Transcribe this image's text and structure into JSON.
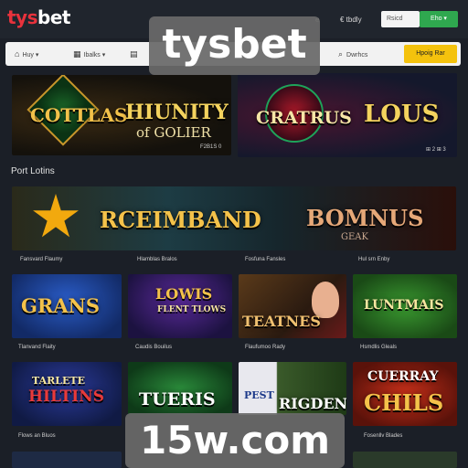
{
  "header": {
    "logo_part1": "tys",
    "logo_part2": "bet",
    "link1": "e",
    "link2": "€ tbdly",
    "input_placeholder": "Rsicd",
    "button_label": "Eho ▾"
  },
  "nav": {
    "item1": "Huy ▾",
    "item2": "Ibalks ▾",
    "search_label": "Dwrhcs",
    "cta_label": "Hpoig Rar"
  },
  "hero": [
    {
      "title": "COTTLAS",
      "title2": "HIUNITY",
      "subtitle": "of GOLIER"
    },
    {
      "title": "CRATRUS",
      "title2": "LOUS",
      "badge": "⊞ 2 ⊞ 3"
    }
  ],
  "hero_caption1": "F2B1S 0",
  "section": {
    "title": "Port Lotins"
  },
  "feature": {
    "title1": "RCEIMBAND",
    "title2": "BOMNUS",
    "subtitle2": "GEAK",
    "captions": [
      "Fansvard Flaumy",
      "Hlamblas Bralos",
      "Fosfuna Fansles",
      "Hul srn Enby"
    ]
  },
  "row1": [
    {
      "title": "GRANS",
      "caption": "Tlanvand Flaity"
    },
    {
      "title": "LOWIS",
      "title_sub": "FLENT TLOWS",
      "caption": "Caudis Bouilus"
    },
    {
      "title": "TEATNES",
      "caption": "Flaufumoo Rady"
    },
    {
      "title": "LUNTMAIS",
      "caption": "Hsmdlis Gleals"
    }
  ],
  "row2": [
    {
      "title": "TARLETE",
      "title2": "HILTINS",
      "caption": "Flows an Bluos"
    },
    {
      "title": "TUERIS",
      "caption": ""
    },
    {
      "title": "PEST",
      "title2": "RIGDEN",
      "caption": ""
    },
    {
      "title": "CUERRAY",
      "title2": "CHILS",
      "caption": "Fosenllv Blades"
    }
  ],
  "watermark_top": "tysbet",
  "watermark_bottom": "15w.com",
  "colors": {
    "brand_red": "#e8323c",
    "green": "#2fa84f",
    "yellow": "#f4c20d"
  }
}
